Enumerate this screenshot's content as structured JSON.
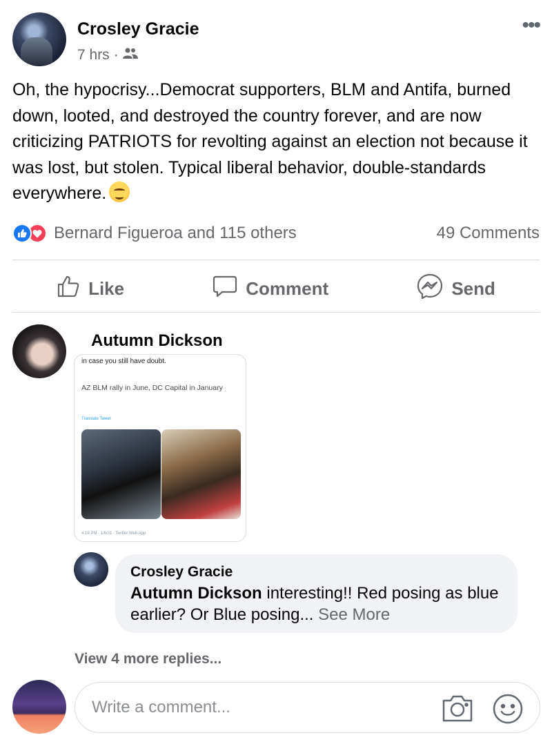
{
  "post": {
    "author": "Crosley Gracie",
    "time": "7 hrs",
    "separator": "·",
    "audience_icon": "friends-icon",
    "text": "Oh, the hypocrisy...Democrat supporters, BLM and Antifa, burned down, looted, and destroyed the country forever, and are now criticizing PATRIOTS for revolting against an election not because it was lost, but stolen. Typical liberal behavior, double-standards everywhere.",
    "emoji": "woozy-face-emoji"
  },
  "reactions": {
    "summary": "Bernard Figueroa and 115 others",
    "comments": "49 Comments",
    "like_color": "#1877f2",
    "love_color": "#f33e58"
  },
  "actions": {
    "like": "Like",
    "comment": "Comment",
    "send": "Send"
  },
  "comment": {
    "author": "Autumn Dickson",
    "tweet": {
      "lead": "in case you still have doubt.",
      "body": "AZ BLM rally in June, DC Capital in January",
      "translate": "Translate Tweet",
      "footer": "4:19 PM · 1/6/21 · Twitter Web App"
    }
  },
  "reply": {
    "author": "Crosley Gracie",
    "mention": "Autumn Dickson",
    "text": " interesting!! Red posing as blue earlier? Or Blue posing...",
    "see_more": " See More"
  },
  "view_more_replies": "View 4 more replies...",
  "composer": {
    "placeholder": "Write a comment..."
  }
}
